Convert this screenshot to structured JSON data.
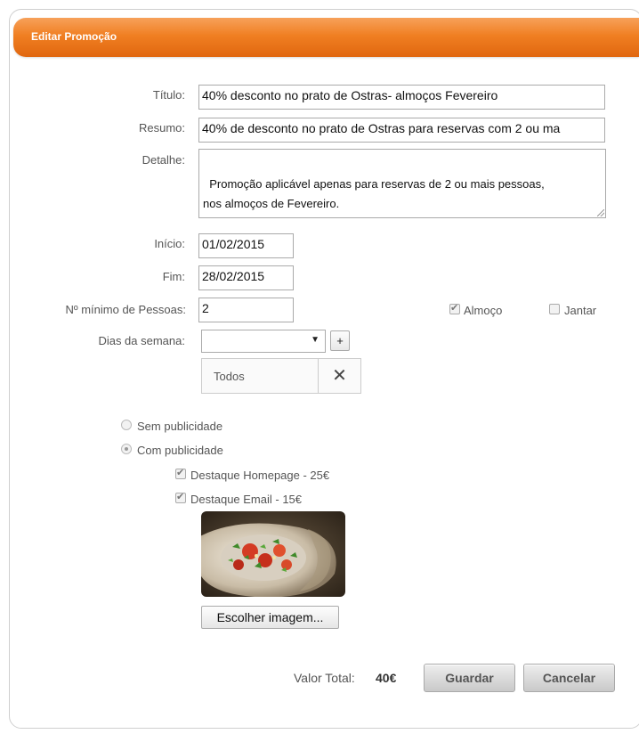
{
  "header": {
    "title": "Editar Promoção"
  },
  "form": {
    "titulo": {
      "label": "Título:",
      "value": "40% desconto no prato de Ostras- almoços Fevereiro"
    },
    "resumo": {
      "label": "Resumo:",
      "value": "40% de desconto no prato de Ostras para reservas com 2 ou ma"
    },
    "detalhe": {
      "label": "Detalhe:",
      "value": "Promoção aplicável apenas para reservas de 2 ou mais pessoas,\nnos almoços de Fevereiro."
    },
    "inicio": {
      "label": "Início:",
      "value": "01/02/2015"
    },
    "fim": {
      "label": "Fim:",
      "value": "28/02/2015"
    },
    "min_pessoas": {
      "label": "Nº mínimo de Pessoas:",
      "value": "2"
    },
    "almoco": {
      "label": "Almoço",
      "checked": true
    },
    "jantar": {
      "label": "Jantar",
      "checked": false
    },
    "dias_semana": {
      "label": "Dias da semana:",
      "selected": "",
      "add_label": "+"
    },
    "dias_tags": [
      {
        "label": "Todos",
        "remove_icon": "close-icon"
      }
    ]
  },
  "publicidade": {
    "sem": {
      "label": "Sem publicidade",
      "checked": false
    },
    "com": {
      "label": "Com publicidade",
      "checked": true
    },
    "destaque_homepage": {
      "label": "Destaque Homepage - 25€",
      "checked": true
    },
    "destaque_email": {
      "label": "Destaque Email - 15€",
      "checked": true
    }
  },
  "image": {
    "button_label": "Escolher imagem..."
  },
  "footer": {
    "total_label": "Valor Total:",
    "total_value": "40€",
    "save_label": "Guardar",
    "cancel_label": "Cancelar"
  },
  "colors": {
    "header_orange": "#f07f22",
    "header_dark": "#e0670f"
  }
}
